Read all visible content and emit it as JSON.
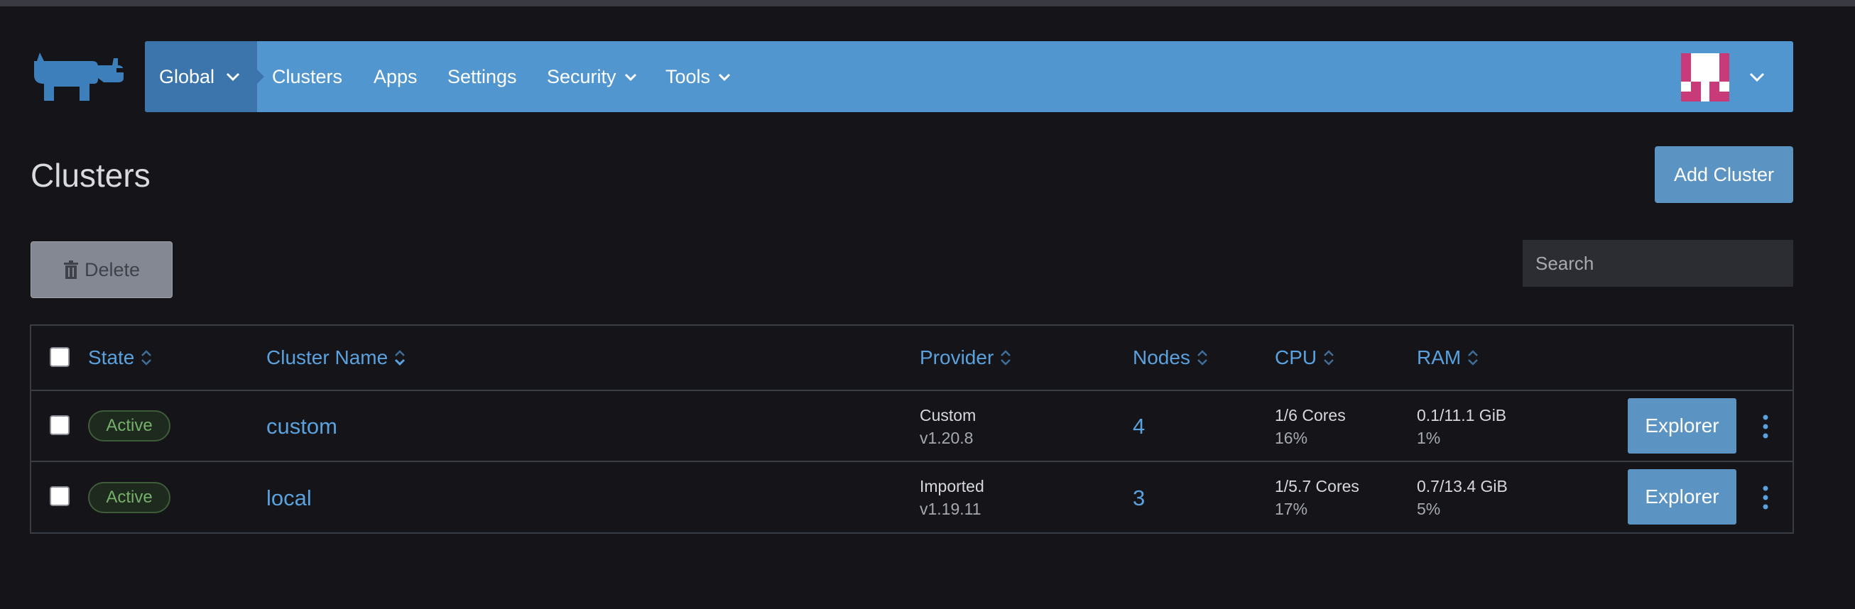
{
  "nav": {
    "global": "Global",
    "clusters": "Clusters",
    "apps": "Apps",
    "settings": "Settings",
    "security": "Security",
    "tools": "Tools"
  },
  "page": {
    "title": "Clusters",
    "add_cluster": "Add Cluster",
    "delete": "Delete",
    "search_placeholder": "Search"
  },
  "table": {
    "headers": {
      "state": "State",
      "cluster_name": "Cluster Name",
      "provider": "Provider",
      "nodes": "Nodes",
      "cpu": "CPU",
      "ram": "RAM"
    },
    "rows": [
      {
        "state": "Active",
        "name": "custom",
        "provider": "Custom",
        "version": "v1.20.8",
        "nodes": "4",
        "cpu": "1/6 Cores",
        "cpu_pct": "16%",
        "ram": "0.1/11.1 GiB",
        "ram_pct": "1%",
        "action": "Explorer"
      },
      {
        "state": "Active",
        "name": "local",
        "provider": "Imported",
        "version": "v1.19.11",
        "nodes": "3",
        "cpu": "1/5.7 Cores",
        "cpu_pct": "17%",
        "ram": "0.7/13.4 GiB",
        "ram_pct": "5%",
        "action": "Explorer"
      }
    ]
  },
  "colors": {
    "navbar": "#5196cf",
    "nav_active": "#3c74ac",
    "link": "#5aa1dd",
    "button": "#5b93c2",
    "active_badge": "#74b06a",
    "background": "#141419"
  }
}
